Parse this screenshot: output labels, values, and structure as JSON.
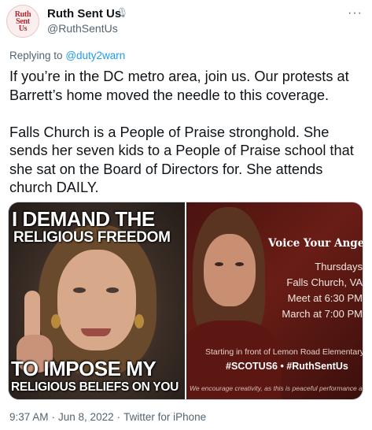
{
  "tweet": {
    "author": {
      "display_name": "Ruth Sent Us",
      "handle": "@RuthSentUs",
      "name_badge": "🎙",
      "avatar_lines": [
        "Ruth",
        "Sent",
        "Us"
      ]
    },
    "more_label": "···",
    "reply_prefix": "Replying to",
    "reply_to": "@duty2warn",
    "paragraphs": [
      "If you’re in the DC metro area, join us. Our protests at Barrett’s home moved the needle to this coverage.",
      "Falls Church is a People of Praise stronghold. She sends her seven kids to a People of Praise school that she sat on the Board of Directors for. She attends church DAILY."
    ],
    "images": {
      "left": {
        "top_line_1": "I DEMAND THE",
        "top_line_2": "RELIGIOUS FREEDOM",
        "bottom_line_1": "TO IMPOSE MY",
        "bottom_line_2": "RELIGIOUS BELIEFS ON YOU"
      },
      "right": {
        "title": "Voice Your Anger",
        "lines": [
          "Thursdays",
          "Falls Church, VA",
          "Meet at 6:30 PM",
          "March at 7:00 PM"
        ],
        "starting": "Starting in front of Lemon Road Elementary",
        "hashtags": "#SCOTUS6 • #RuthSentUs",
        "footnote": "We encourage creativity, as this is peaceful performance art"
      }
    },
    "timestamp": {
      "time": "9:37 AM",
      "separator": "·",
      "date": "Jun 8, 2022",
      "source": "Twitter for iPhone"
    }
  }
}
